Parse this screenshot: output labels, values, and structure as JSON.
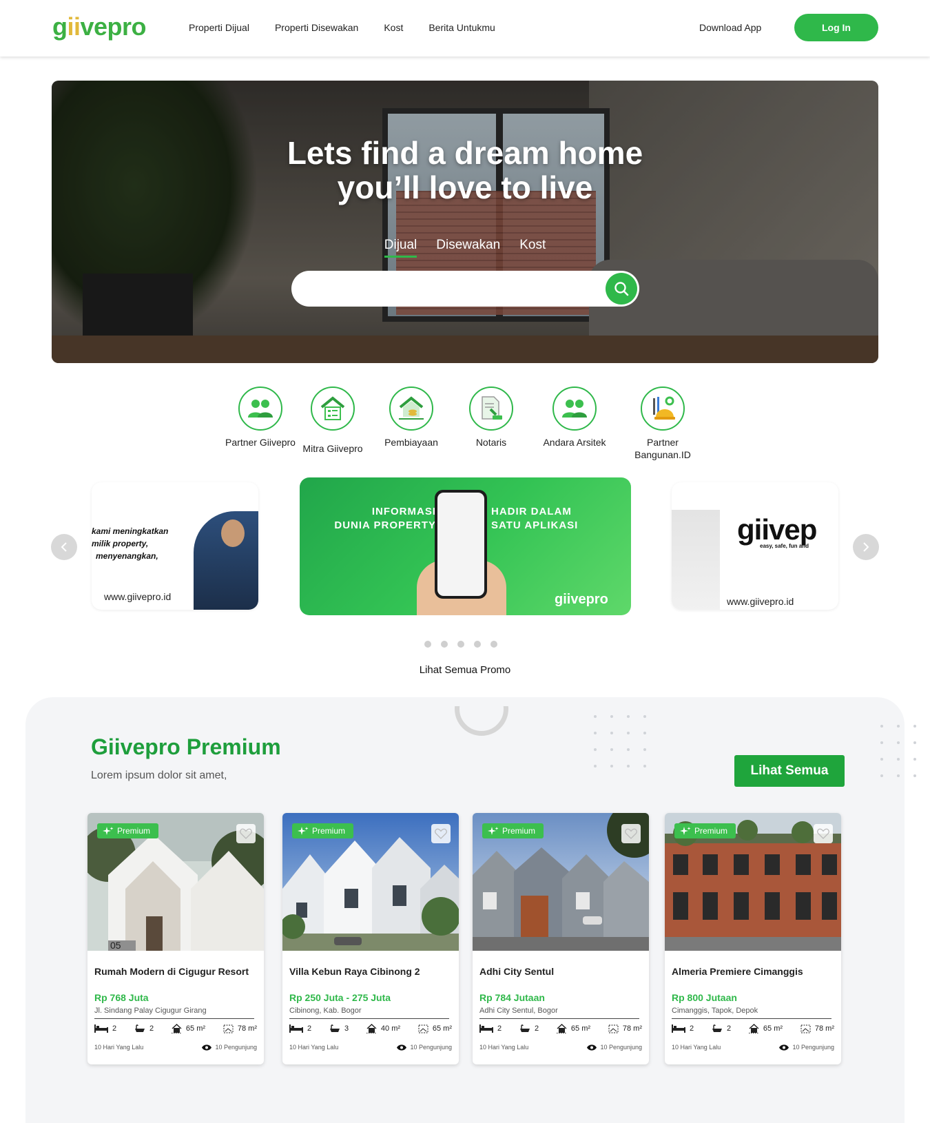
{
  "header": {
    "logo": "giivepro",
    "nav": [
      "Properti Dijual",
      "Properti Disewakan",
      "Kost",
      "Berita Untukmu"
    ],
    "download": "Download App",
    "login": "Log In"
  },
  "hero": {
    "title_line1": "Lets find a dream home",
    "title_line2": "you’ll love to live",
    "tabs": [
      "Dijual",
      "Disewakan",
      "Kost"
    ],
    "active_tab": "Dijual",
    "search_placeholder": ""
  },
  "services": [
    {
      "label": "Partner Giivepro",
      "icon": "people-icon"
    },
    {
      "label": "Mitra Giivepro",
      "icon": "house-checklist-icon"
    },
    {
      "label": "Pembiayaan",
      "icon": "house-coins-icon"
    },
    {
      "label": "Notaris",
      "icon": "document-stamp-icon"
    },
    {
      "label": "Andara Arsitek",
      "icon": "people-icon"
    },
    {
      "label": "Partner Bangunan.ID",
      "icon": "hardhat-tools-icon"
    }
  ],
  "promos": {
    "left": {
      "text_line1": "kami meningkatkan",
      "text_line2": "milik property,",
      "text_line3": "menyenangkan,",
      "url": "www.giivepro.id"
    },
    "middle": {
      "text_left_1": "INFORMASI",
      "text_left_2": "DUNIA PROPERTY",
      "text_right_1": "HADIR DALAM",
      "text_right_2": "SATU APLIKASI",
      "brand": "giivepro"
    },
    "right": {
      "brand": "giivep",
      "tagline": "easy, safe, fun and",
      "url": "www.giivepro.id"
    },
    "dots": 5,
    "see_all": "Lihat Semua Promo"
  },
  "premium": {
    "title": "Giivepro Premium",
    "subtitle": "Lorem ipsum dolor sit amet,",
    "see_all": "Lihat Semua",
    "badge": "Premium",
    "cards": [
      {
        "name": "Rumah Modern di Cigugur Resort",
        "price": "Rp 768 Juta",
        "address": "Jl. Sindang Palay  Cigugur Girang",
        "beds": "2",
        "baths": "2",
        "building": "65 m²",
        "land": "78 m²",
        "posted": "10 Hari Yang Lalu",
        "visitors": "10 Pengunjung",
        "house_number": "05"
      },
      {
        "name": "Villa Kebun Raya Cibinong 2",
        "price": "Rp 250 Juta - 275 Juta",
        "address": "Cibinong, Kab. Bogor",
        "beds": "2",
        "baths": "3",
        "building": "40 m²",
        "land": "65 m²",
        "posted": "10 Hari Yang Lalu",
        "visitors": "10 Pengunjung"
      },
      {
        "name": "Adhi City Sentul",
        "price": "Rp 784 Jutaan",
        "address": "Adhi City Sentul, Bogor",
        "beds": "2",
        "baths": "2",
        "building": "65 m²",
        "land": "78 m²",
        "posted": "10 Hari Yang Lalu",
        "visitors": "10 Pengunjung"
      },
      {
        "name": "Almeria Premiere Cimanggis",
        "price": "Rp 800 Jutaan",
        "address": "Cimanggis, Tapok, Depok",
        "beds": "2",
        "baths": "2",
        "building": "65 m²",
        "land": "78 m²",
        "posted": "10 Hari Yang Lalu",
        "visitors": "10 Pengunjung"
      }
    ]
  },
  "colors": {
    "brand_green": "#2fb84a",
    "brand_yellow": "#e2b93b",
    "premium_title": "#1e9e3c"
  }
}
